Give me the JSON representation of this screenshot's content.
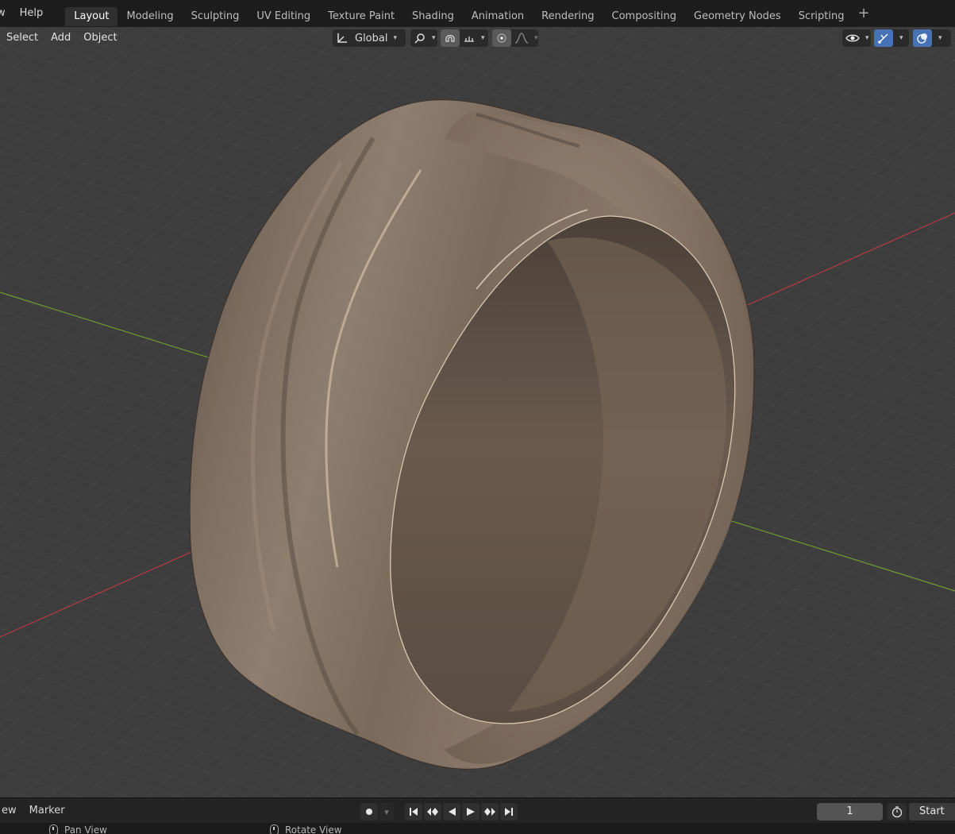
{
  "menu": {
    "view_cut": "w",
    "help": "Help"
  },
  "workspace_tabs": [
    {
      "label": "Layout",
      "active": true
    },
    {
      "label": "Modeling",
      "active": false
    },
    {
      "label": "Sculpting",
      "active": false
    },
    {
      "label": "UV Editing",
      "active": false
    },
    {
      "label": "Texture Paint",
      "active": false
    },
    {
      "label": "Shading",
      "active": false
    },
    {
      "label": "Animation",
      "active": false
    },
    {
      "label": "Rendering",
      "active": false
    },
    {
      "label": "Compositing",
      "active": false
    },
    {
      "label": "Geometry Nodes",
      "active": false
    },
    {
      "label": "Scripting",
      "active": false
    }
  ],
  "add_tab": "+",
  "viewport_header": {
    "select": "Select",
    "add": "Add",
    "object": "Object",
    "orientation": "Global",
    "icons": [
      "transform-orientation-icon",
      "pivot-link-icon",
      "snap-magnet-icon",
      "snap-increment-icon",
      "proportional-edit-icon",
      "falloff-curve-icon",
      "visibility-eye-icon",
      "gizmo-icon",
      "overlay-icon"
    ]
  },
  "viewport": {
    "object": "ring",
    "colors": {
      "ring_base": "#8a7a6a",
      "ring_highlight": "#c8b6a2",
      "ring_shadow": "#4a3e34",
      "grid_line": "#4a4a4a",
      "grid_bg": "#3d3d3d",
      "x_axis": "#c0404a",
      "y_axis": "#6c9a2e"
    }
  },
  "timeline": {
    "view_cut": "ew",
    "marker": "Marker",
    "current_frame": "1",
    "start_label": "Start",
    "buttons": [
      "record-icon",
      "jump-start-icon",
      "prev-keyframe-icon",
      "play-reverse-icon",
      "play-icon",
      "next-keyframe-icon",
      "jump-end-icon"
    ]
  },
  "status": {
    "pan": "Pan View",
    "rotate": "Rotate View"
  }
}
